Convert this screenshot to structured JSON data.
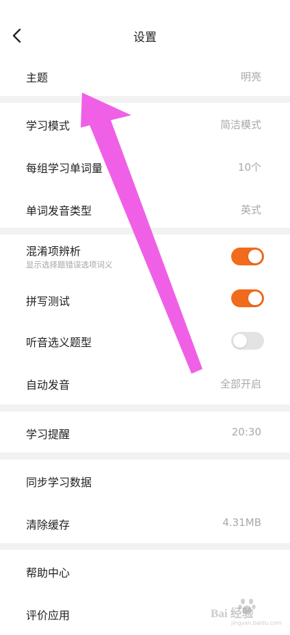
{
  "header": {
    "title": "设置"
  },
  "sections": {
    "theme": {
      "label": "主题",
      "value": "明亮"
    },
    "study_mode": {
      "label": "学习模式",
      "value": "简洁模式"
    },
    "words_per_group": {
      "label": "每组学习单词量",
      "value": "10个"
    },
    "pronunciation": {
      "label": "单词发音类型",
      "value": "英式"
    },
    "confusion": {
      "label": "混淆项辨析",
      "sub": "显示选择题错误选项词义",
      "enabled": true
    },
    "spelling_test": {
      "label": "拼写测试",
      "enabled": true
    },
    "listening_type": {
      "label": "听音选义题型",
      "enabled": false
    },
    "auto_pronounce": {
      "label": "自动发音",
      "value": "全部开启"
    },
    "reminder": {
      "label": "学习提醒",
      "value": "20:30"
    },
    "sync": {
      "label": "同步学习数据"
    },
    "clear_cache": {
      "label": "清除缓存",
      "value": "4.31MB"
    },
    "help": {
      "label": "帮助中心"
    },
    "rate_app": {
      "label": "评价应用"
    }
  },
  "watermark": {
    "text": "Bai 经验",
    "sub": "jingyan.baidu.com"
  },
  "colors": {
    "accent": "#f26a1b",
    "toggle_off": "#e3e3e3",
    "annotation_arrow": "#f060e6",
    "section_gap": "#f2f2f2"
  }
}
